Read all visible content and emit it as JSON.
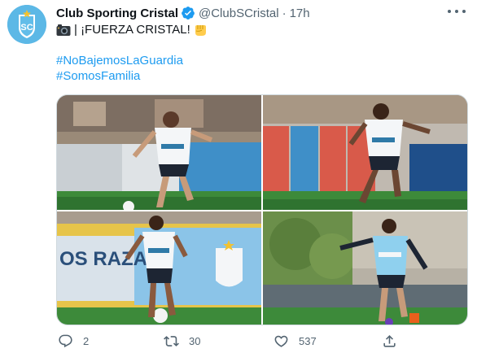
{
  "account": {
    "display_name": "Club Sporting Cristal",
    "handle": "@ClubSCristal",
    "separator": "·",
    "time": "17h",
    "avatar_text": "SC"
  },
  "tweet": {
    "text": "| ¡FUERZA CRISTAL!",
    "hashtags": [
      "#NoBajemosLaGuardia",
      "#SomosFamilia"
    ]
  },
  "photos": [
    {
      "banner_text": ""
    },
    {
      "banner_text": ""
    },
    {
      "banner_text": "OS RAZA"
    },
    {
      "banner_text": ""
    }
  ],
  "actions": {
    "replies": "2",
    "retweets": "30",
    "likes": "537"
  },
  "icons": {
    "avatar": "club-crest-icon",
    "verified": "verified-badge-icon",
    "camera": "camera-emoji-icon",
    "fist": "fist-emoji-icon",
    "more": "more-options-icon",
    "reply": "reply-icon",
    "retweet": "retweet-icon",
    "like": "heart-icon",
    "share": "share-icon"
  },
  "colors": {
    "accent": "#1d9bf0",
    "text": "#0f1419",
    "muted": "#536471",
    "border": "#cfd9de",
    "club_blue": "#5cb8e6"
  }
}
